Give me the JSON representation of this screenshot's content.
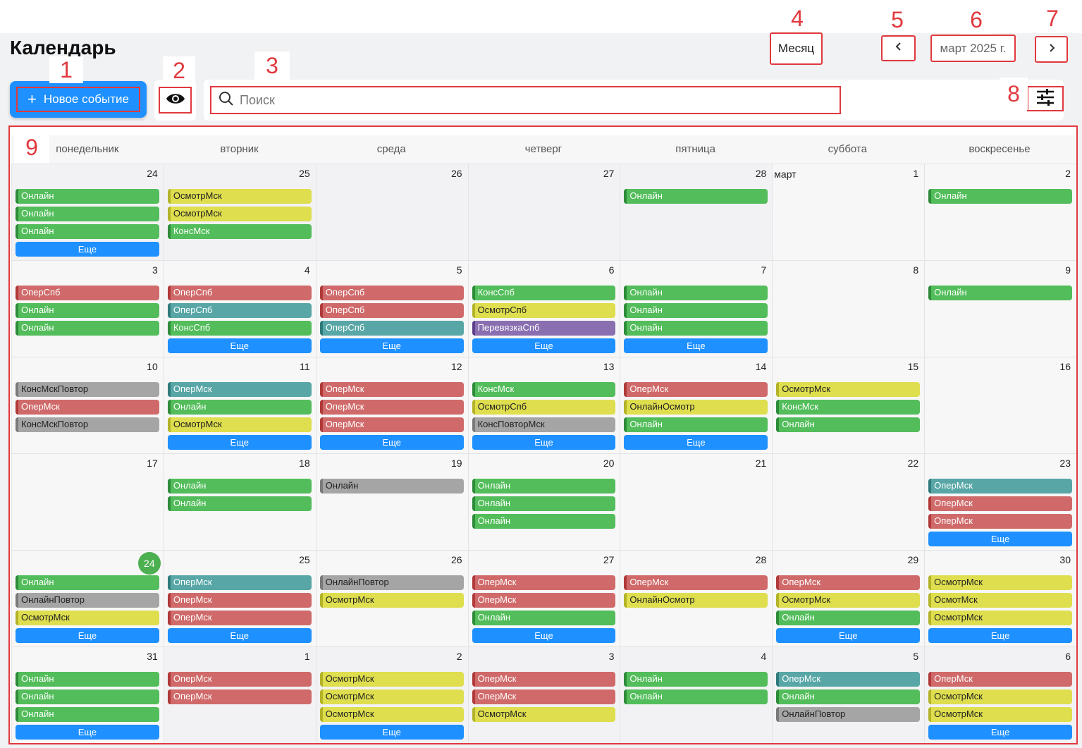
{
  "header": {
    "title": "Календарь",
    "view_label": "Месяц",
    "date_label": "март 2025 г.",
    "new_event_label": "Новое событие"
  },
  "search": {
    "placeholder": "Поиск",
    "value": ""
  },
  "markers": [
    "1",
    "2",
    "3",
    "4",
    "5",
    "6",
    "7",
    "8",
    "9"
  ],
  "colors": {
    "accent": "#1e90ff",
    "annotation": "#e0393e",
    "today": "#4caf50",
    "green": "#52bd5a",
    "yellow": "#dede4f",
    "red": "#d06a6a",
    "teal": "#58a6a6",
    "gray": "#a5a5a5",
    "purple": "#8a6fb0"
  },
  "icons": {
    "prev": "chevron-left-icon",
    "next": "chevron-right-icon",
    "eye": "eye-icon",
    "search": "search-icon",
    "filter": "sliders-icon",
    "plus": "plus-icon"
  },
  "calendar": {
    "more_label": "Еще",
    "weekdays": [
      "понедельник",
      "вторник",
      "среда",
      "четверг",
      "пятница",
      "суббота",
      "воскресенье"
    ],
    "days": [
      {
        "day": "24",
        "other": true,
        "events": [
          [
            "Онлайн",
            "green"
          ],
          [
            "Онлайн",
            "green"
          ],
          [
            "Онлайн",
            "green"
          ]
        ],
        "more": true
      },
      {
        "day": "25",
        "other": true,
        "events": [
          [
            "ОсмотрМск",
            "yellow"
          ],
          [
            "ОсмотрМск",
            "yellow"
          ],
          [
            "КонсМск",
            "green"
          ]
        ]
      },
      {
        "day": "26",
        "other": true,
        "events": []
      },
      {
        "day": "27",
        "other": true,
        "events": []
      },
      {
        "day": "28",
        "other": true,
        "events": [
          [
            "Онлайн",
            "green"
          ]
        ]
      },
      {
        "day": "1",
        "month": "март",
        "events": []
      },
      {
        "day": "2",
        "events": [
          [
            "Онлайн",
            "green"
          ]
        ]
      },
      {
        "day": "3",
        "events": [
          [
            "ОперСпб",
            "red"
          ],
          [
            "Онлайн",
            "green"
          ],
          [
            "Онлайн",
            "green"
          ]
        ]
      },
      {
        "day": "4",
        "events": [
          [
            "ОперСпб",
            "red"
          ],
          [
            "ОперСпб",
            "teal"
          ],
          [
            "КонсСпб",
            "green"
          ]
        ],
        "more": true
      },
      {
        "day": "5",
        "events": [
          [
            "ОперСпб",
            "red"
          ],
          [
            "ОперСпб",
            "red"
          ],
          [
            "ОперСпб",
            "teal"
          ]
        ],
        "more": true
      },
      {
        "day": "6",
        "events": [
          [
            "КонсСпб",
            "green"
          ],
          [
            "ОсмотрСпб",
            "yellow"
          ],
          [
            "ПеревязкаСпб",
            "purple"
          ]
        ],
        "more": true
      },
      {
        "day": "7",
        "events": [
          [
            "Онлайн",
            "green"
          ],
          [
            "Онлайн",
            "green"
          ],
          [
            "Онлайн",
            "green"
          ]
        ],
        "more": true
      },
      {
        "day": "8",
        "events": []
      },
      {
        "day": "9",
        "events": [
          [
            "Онлайн",
            "green"
          ]
        ]
      },
      {
        "day": "10",
        "events": [
          [
            "КонсМскПовтор",
            "gray"
          ],
          [
            "ОперМск",
            "red"
          ],
          [
            "КонсМскПовтор",
            "gray"
          ]
        ]
      },
      {
        "day": "11",
        "events": [
          [
            "ОперМск",
            "teal"
          ],
          [
            "Онлайн",
            "green"
          ],
          [
            "ОсмотрМск",
            "yellow"
          ]
        ],
        "more": true
      },
      {
        "day": "12",
        "events": [
          [
            "ОперМск",
            "red"
          ],
          [
            "ОперМск",
            "red"
          ],
          [
            "ОперМск",
            "red"
          ]
        ],
        "more": true
      },
      {
        "day": "13",
        "events": [
          [
            "КонсМск",
            "green"
          ],
          [
            "ОсмотрСпб",
            "yellow"
          ],
          [
            "КонсПовторМск",
            "gray"
          ]
        ],
        "more": true
      },
      {
        "day": "14",
        "events": [
          [
            "ОперМск",
            "red"
          ],
          [
            "ОнлайнОсмотр",
            "yellow"
          ],
          [
            "Онлайн",
            "green"
          ]
        ],
        "more": true
      },
      {
        "day": "15",
        "events": [
          [
            "ОсмотрМск",
            "yellow"
          ],
          [
            "КонсМск",
            "green"
          ],
          [
            "Онлайн",
            "green"
          ]
        ]
      },
      {
        "day": "16",
        "events": []
      },
      {
        "day": "17",
        "events": []
      },
      {
        "day": "18",
        "events": [
          [
            "Онлайн",
            "green"
          ],
          [
            "Онлайн",
            "green"
          ]
        ]
      },
      {
        "day": "19",
        "events": [
          [
            "Онлайн",
            "gray"
          ]
        ]
      },
      {
        "day": "20",
        "events": [
          [
            "Онлайн",
            "green"
          ],
          [
            "Онлайн",
            "green"
          ],
          [
            "Онлайн",
            "green"
          ]
        ]
      },
      {
        "day": "21",
        "events": []
      },
      {
        "day": "22",
        "events": []
      },
      {
        "day": "23",
        "events": [
          [
            "ОперМск",
            "teal"
          ],
          [
            "ОперМск",
            "red"
          ],
          [
            "ОперМск",
            "red"
          ]
        ],
        "more": true
      },
      {
        "day": "24",
        "today": true,
        "events": [
          [
            "Онлайн",
            "green"
          ],
          [
            "ОнлайнПовтор",
            "gray"
          ],
          [
            "ОсмотрМск",
            "yellow"
          ]
        ],
        "more": true
      },
      {
        "day": "25",
        "events": [
          [
            "ОперМск",
            "teal"
          ],
          [
            "ОперМск",
            "red"
          ],
          [
            "ОперМск",
            "red"
          ]
        ],
        "more": true
      },
      {
        "day": "26",
        "events": [
          [
            "ОнлайнПовтор",
            "gray"
          ],
          [
            "ОсмотрМск",
            "yellow"
          ]
        ]
      },
      {
        "day": "27",
        "events": [
          [
            "ОперМск",
            "red"
          ],
          [
            "ОперМск",
            "red"
          ],
          [
            "Онлайн",
            "green"
          ]
        ],
        "more": true
      },
      {
        "day": "28",
        "events": [
          [
            "ОперМск",
            "red"
          ],
          [
            "ОнлайнОсмотр",
            "yellow"
          ]
        ]
      },
      {
        "day": "29",
        "events": [
          [
            "ОперМск",
            "red"
          ],
          [
            "ОсмотрМск",
            "yellow"
          ],
          [
            "Онлайн",
            "green"
          ]
        ],
        "more": true
      },
      {
        "day": "30",
        "events": [
          [
            "ОсмотрМск",
            "yellow"
          ],
          [
            "ОсмотМск",
            "yellow"
          ],
          [
            "ОсмотрМск",
            "yellow"
          ]
        ],
        "more": true
      },
      {
        "day": "31",
        "events": [
          [
            "Онлайн",
            "green"
          ],
          [
            "Онлайн",
            "green"
          ],
          [
            "Онлайн",
            "green"
          ]
        ],
        "more": true
      },
      {
        "day": "1",
        "other": true,
        "events": [
          [
            "ОперМск",
            "red"
          ],
          [
            "ОперМск",
            "red"
          ]
        ]
      },
      {
        "day": "2",
        "other": true,
        "events": [
          [
            "ОсмотрМск",
            "yellow"
          ],
          [
            "ОсмотрМск",
            "yellow"
          ],
          [
            "ОсмотрМск",
            "yellow"
          ]
        ],
        "more": true
      },
      {
        "day": "3",
        "other": true,
        "events": [
          [
            "ОперМск",
            "red"
          ],
          [
            "ОперМск",
            "red"
          ],
          [
            "ОсмотрМск",
            "yellow"
          ]
        ]
      },
      {
        "day": "4",
        "other": true,
        "events": [
          [
            "Онлайн",
            "green"
          ],
          [
            "Онлайн",
            "green"
          ]
        ]
      },
      {
        "day": "5",
        "other": true,
        "events": [
          [
            "ОперМск",
            "teal"
          ],
          [
            "Онлайн",
            "green"
          ],
          [
            "ОнлайнПовтор",
            "gray"
          ]
        ]
      },
      {
        "day": "6",
        "other": true,
        "events": [
          [
            "ОперМск",
            "red"
          ],
          [
            "ОсмотрМск",
            "yellow"
          ],
          [
            "ОсмотрМск",
            "yellow"
          ]
        ],
        "more": true
      }
    ]
  }
}
